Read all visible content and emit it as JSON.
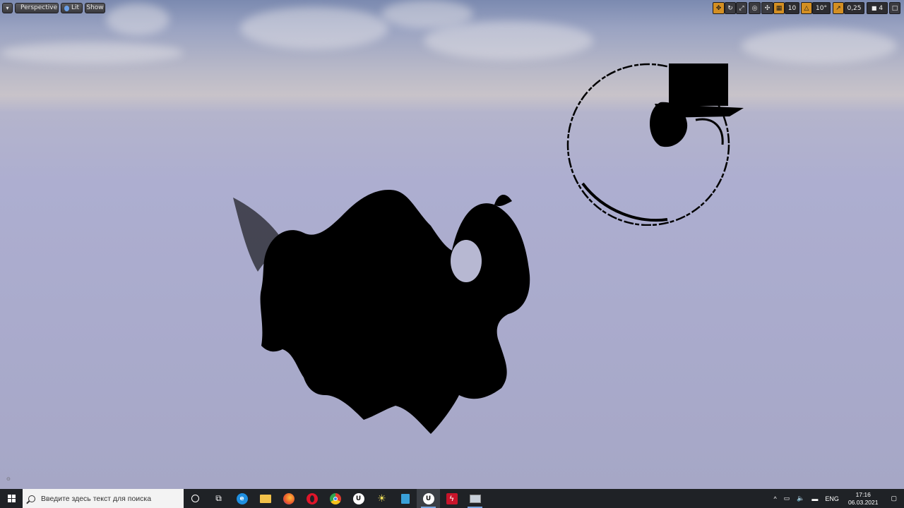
{
  "viewport_toolbar": {
    "perspective_label": "Perspective",
    "lit_label": "Lit",
    "show_label": "Show"
  },
  "right_toolbar": {
    "grid_snap_value": "10",
    "rotation_snap_value": "10°",
    "scale_snap_value": "0,25",
    "camera_speed_value": "4"
  },
  "taskbar": {
    "search_placeholder": "Введите здесь текст для поиска",
    "language": "ENG",
    "time": "17:16",
    "date": "06.03.2021"
  },
  "colors": {
    "accent_orange": "#d48f22",
    "taskbar_bg": "#1f2226"
  }
}
